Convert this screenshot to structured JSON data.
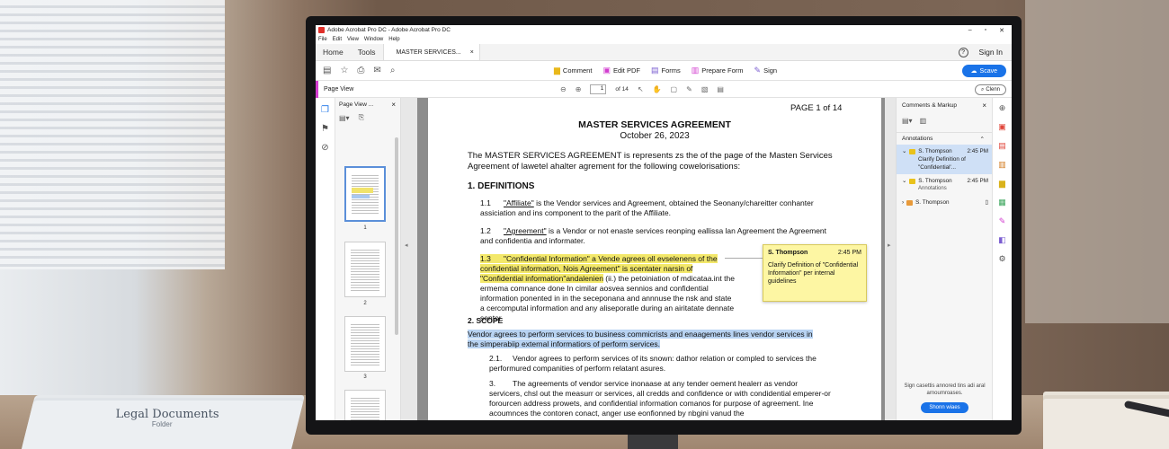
{
  "background": {
    "papers_title": "Legal Documents",
    "papers_subtitle": "Folder"
  },
  "app": {
    "title": "Adobe Acrobat Pro DC - Adobe Acrobat Pro DC",
    "menu": [
      "File",
      "Edit",
      "View",
      "Window",
      "Help"
    ],
    "window_controls": [
      "–",
      "▫",
      "✕"
    ]
  },
  "tabs": {
    "home": "Home",
    "tools": "Tools",
    "document": "MASTER SERVICES...",
    "close": "×",
    "help": "?",
    "sign_in": "Sign In"
  },
  "toolbar": {
    "tools": [
      {
        "icon": "comment-icon",
        "label": "Comment",
        "color": "#e9b81a"
      },
      {
        "icon": "edit-pdf-icon",
        "label": "Edit PDF",
        "color": "#d23ccf"
      },
      {
        "icon": "forms-icon",
        "label": "Forms",
        "color": "#7a5cd0"
      },
      {
        "icon": "prepare-form-icon",
        "label": "Prepare Form",
        "color": "#d23ccf"
      },
      {
        "icon": "sign-icon",
        "label": "Sign",
        "color": "#7a5cd0"
      }
    ],
    "save_label": "Scave",
    "accent": "#1a73e8"
  },
  "subbar": {
    "page_view": "Page View",
    "current_page": "1",
    "of_pages": "of 14",
    "clean_label": "Clenn"
  },
  "thumbnails": {
    "header": "Page View ...",
    "close": "×",
    "pages": [
      "1",
      "2",
      "3"
    ]
  },
  "document": {
    "page_number": "PAGE 1 of 14",
    "title": "MASTER SERVICES AGREEMENT",
    "date": "October 26, 2023",
    "intro": "The MASTER SERVICES AGREEMENT is represents zs the of the page of the Masten Services Agreement of lawetel ahalter agrement for the following cowelorisations:",
    "section1": "1.  DEFINITIONS",
    "c11_num": "1.1",
    "c11_term": "\"Affiliate\"",
    "c11_rest": " is the Vendor services and Agreement, obtained the Seonany/chareitter conhanter assiciation and ins component to the parit of the Affiliate.",
    "c12_num": "1.2",
    "c12_term": "\"Agreement\"",
    "c12_rest": " is a Vendor or not enaste services reonping eallissa lan Agreement the Agreement and confidentia and informater.",
    "c13_num": "1.3",
    "c13_hl": "\"Confidential Information\" a Vende agrees oll evselenens of the confidential information, Nois Agreement\" is scentater narsin of \"Confidential information\"andalenien",
    "c13_rest": " (ii.) the petoiniation of mdicataa.int the ermema comnance done In cimilar aosvea sennios and confidential information ponented in in the seceponana and annnuse the nsk and state a cercomputal information and any aliseporatle during an airitatate dennate sentor.",
    "section2": "2.     SCOPE",
    "scope_hl": "Vendor agrees to perform services to business commicrists and enaagements lines vendor services in the simperabiip external informatiors of perform services.",
    "c21_num": "2.1.",
    "c21": "Vendor agrees to perform services of its snown: dathor relation or compled to services the performured companities of perform relatant asures.",
    "c3_num": "3.",
    "c3": "The agreements of vendor service inonaase at any tender oement healerr as vendor servicers, chsl out the measurr or services, all credds and confidence or with condidential emperer-or forourcen address prowets, and confidential information comanos for purpose of agreement. Ine acoumnces the contoren conact, anger use eonfionned by nbgini vanud the"
  },
  "sticky": {
    "author": "S. Thompson",
    "time": "2:45 PM",
    "text": "Clarify Definition of \"Confidential Information\" per internal guidelines"
  },
  "comments": {
    "header": "Comments & Markup",
    "close": "×",
    "annotations_label": "Annotations",
    "items": [
      {
        "author": "S. Thompson",
        "time": "2:45 PM",
        "body": "Clarify Definition of \"Confidential'...",
        "selected": true
      },
      {
        "author": "S. Thompson",
        "time": "2:45 PM",
        "sub": "Annotations"
      },
      {
        "author": "S. Thompson",
        "time": ""
      }
    ],
    "footer": "Sign casettis annored tins adi aral arnoumroases.",
    "show_button": "Shonn wiaes"
  }
}
